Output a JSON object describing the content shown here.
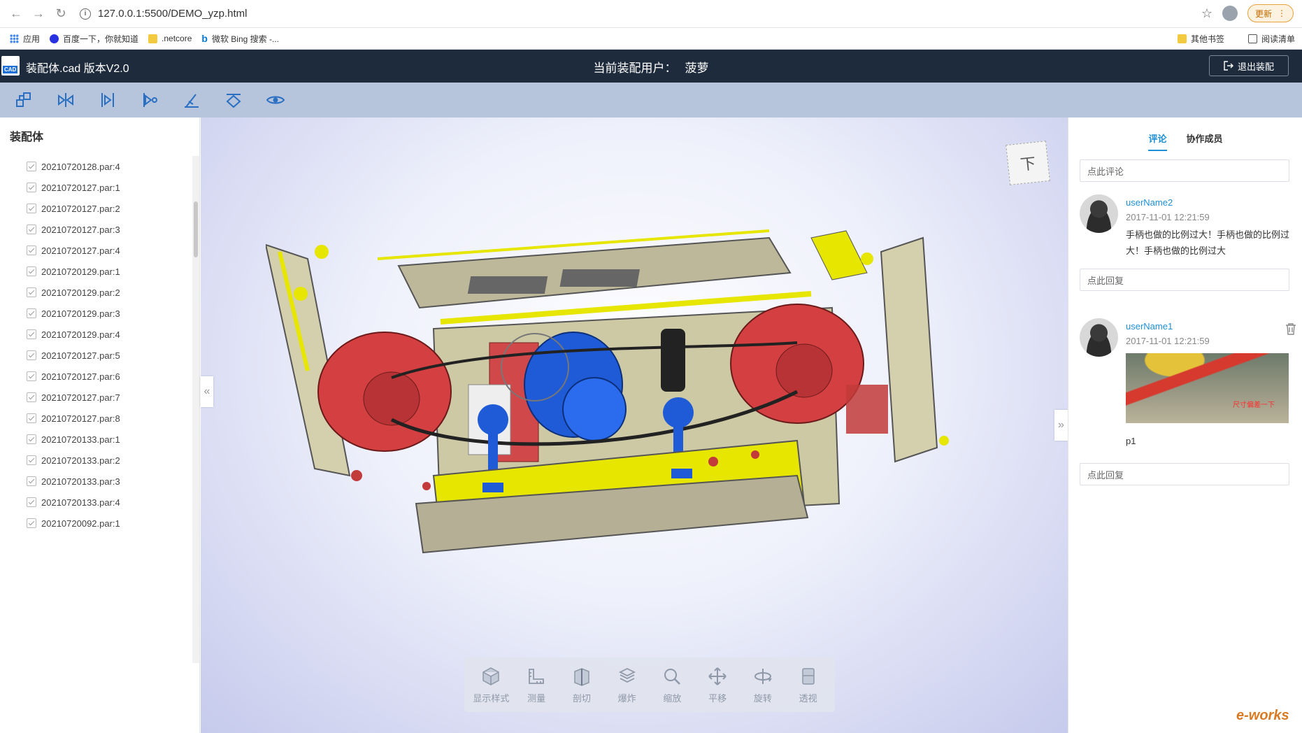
{
  "browser": {
    "url": "127.0.0.1:5500/DEMO_yzp.html",
    "update_label": "更新",
    "bookmarks": [
      "应用",
      "百度一下，你就知道",
      ".netcore",
      "微软 Bing 搜索 -..."
    ],
    "bookmarks_right": [
      "其他书签",
      "阅读清单"
    ]
  },
  "header": {
    "title": "装配体.cad  版本V2.0",
    "user_label": "当前装配用户：",
    "user_name": "菠萝",
    "exit_label": "退出装配",
    "logo_text": "CAD"
  },
  "left_panel": {
    "title": "装配体",
    "items": [
      "20210720128.par:4",
      "20210720127.par:1",
      "20210720127.par:2",
      "20210720127.par:3",
      "20210720127.par:4",
      "20210720129.par:1",
      "20210720129.par:2",
      "20210720129.par:3",
      "20210720129.par:4",
      "20210720127.par:5",
      "20210720127.par:6",
      "20210720127.par:7",
      "20210720127.par:8",
      "20210720133.par:1",
      "20210720133.par:2",
      "20210720133.par:3",
      "20210720133.par:4",
      "20210720092.par:1"
    ]
  },
  "viewport": {
    "view_cube_face": "下",
    "collapse_left": "«",
    "collapse_right": "»"
  },
  "bottom_tools": [
    "显示样式",
    "测量",
    "剖切",
    "爆炸",
    "缩放",
    "平移",
    "旋转",
    "透视"
  ],
  "right_panel": {
    "tabs": [
      "评论",
      "协作成员"
    ],
    "comment_placeholder": "点此评论",
    "reply_placeholder": "点此回复",
    "comments": [
      {
        "user": "userName2",
        "time": "2017-11-01 12:21:59",
        "text": "手柄也做的比例过大！手柄也做的比例过大！手柄也做的比例过大"
      },
      {
        "user": "userName1",
        "time": "2017-11-01 12:21:59",
        "image_note": "尺寸偏差一下",
        "caption": "p1"
      }
    ]
  },
  "watermark": "e-works"
}
